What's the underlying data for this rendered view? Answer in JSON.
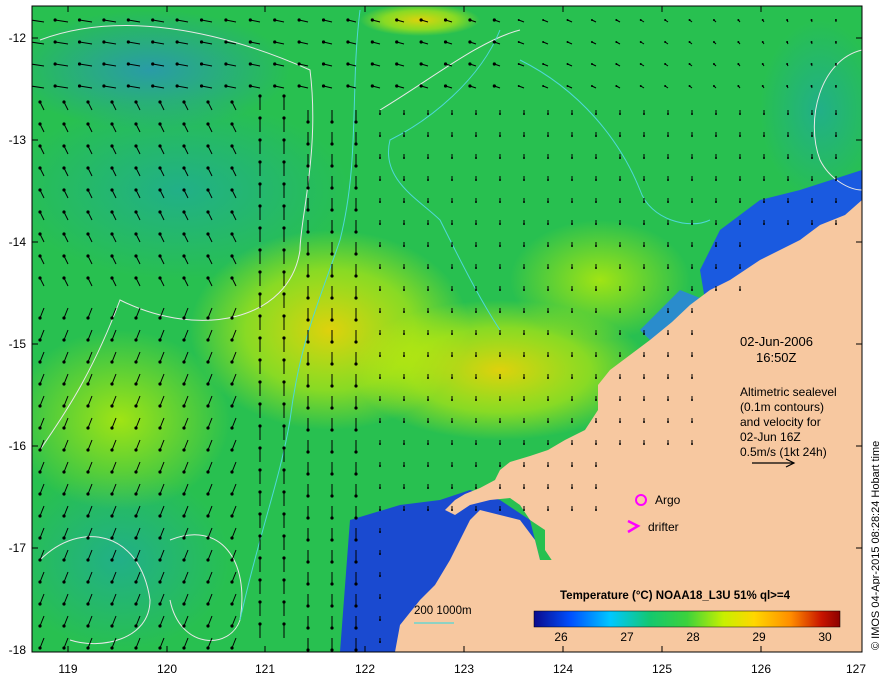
{
  "date_label": "02-Jun-2006",
  "time_label": "16:50Z",
  "altimetry_note": [
    "Altimetric sealevel",
    "(0.1m contours)",
    "and velocity for",
    "02-Jun 16Z",
    "0.5m/s (1kt 24h)"
  ],
  "legend": {
    "argo": "Argo",
    "drifter": "drifter",
    "argo_color": "#ff00ff",
    "drifter_color": "#ff00ff"
  },
  "colorbar": {
    "title": "Temperature (°C) NOAA18_L3U 51% ql>=4",
    "ticks": [
      "26",
      "27",
      "28",
      "29",
      "30"
    ],
    "min": 25.6,
    "max": 30.6,
    "colors": [
      "#0a0a8c",
      "#0050ff",
      "#00c8ff",
      "#14c86e",
      "#3cd23c",
      "#c8f000",
      "#ffd700",
      "#ff8c00",
      "#c81400",
      "#8c0000"
    ]
  },
  "depth_label": "200  1000m",
  "credit": "© IMOS 04-Apr-2015 08:28:24 Hobart time",
  "axes": {
    "lon_ticks": [
      "119",
      "120",
      "121",
      "122",
      "123",
      "124",
      "125",
      "126",
      "127"
    ],
    "lat_ticks": [
      "-12",
      "-13",
      "-14",
      "-15",
      "-16",
      "-17",
      "-18"
    ],
    "lon_range": [
      118.7,
      127.0
    ],
    "lat_range": [
      -11.8,
      -18.0
    ]
  },
  "colors": {
    "land": "#f7c8a0",
    "contour": "#e8e8e8",
    "isobath": "#4fd8d8",
    "arrow": "#000000"
  }
}
